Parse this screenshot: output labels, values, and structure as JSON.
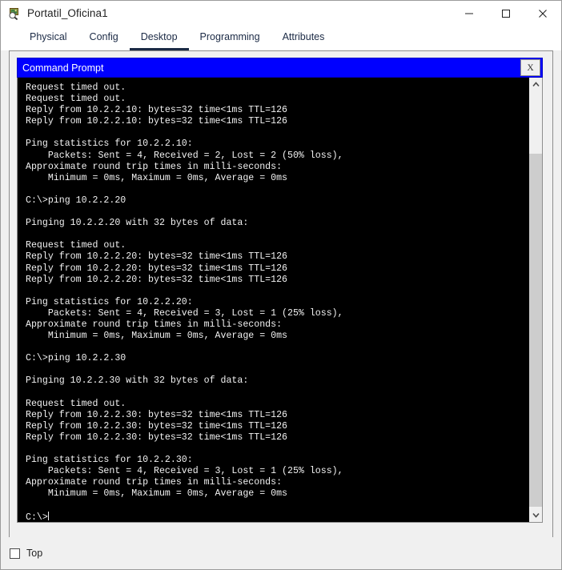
{
  "window": {
    "title": "Portatil_Oficina1",
    "icon": "packet-tracer-icon",
    "controls": {
      "minimize": "—",
      "maximize": "☐",
      "close": "✕"
    }
  },
  "tabs": [
    {
      "label": "Physical",
      "active": false
    },
    {
      "label": "Config",
      "active": false
    },
    {
      "label": "Desktop",
      "active": true
    },
    {
      "label": "Programming",
      "active": false
    },
    {
      "label": "Attributes",
      "active": false
    }
  ],
  "cmd_window": {
    "title": "Command Prompt",
    "close_label": "X",
    "accent_color": "#0000ff",
    "terminal_bg": "#000000",
    "terminal_fg": "#f2f2f2",
    "scrollbar": {
      "up_arrow": "∧",
      "down_arrow": "∨",
      "thumb_color": "#cdcdcd"
    },
    "terminal_text": "Request timed out.\nRequest timed out.\nReply from 10.2.2.10: bytes=32 time<1ms TTL=126\nReply from 10.2.2.10: bytes=32 time<1ms TTL=126\n\nPing statistics for 10.2.2.10:\n    Packets: Sent = 4, Received = 2, Lost = 2 (50% loss),\nApproximate round trip times in milli-seconds:\n    Minimum = 0ms, Maximum = 0ms, Average = 0ms\n\nC:\\>ping 10.2.2.20\n\nPinging 10.2.2.20 with 32 bytes of data:\n\nRequest timed out.\nReply from 10.2.2.20: bytes=32 time<1ms TTL=126\nReply from 10.2.2.20: bytes=32 time<1ms TTL=126\nReply from 10.2.2.20: bytes=32 time<1ms TTL=126\n\nPing statistics for 10.2.2.20:\n    Packets: Sent = 4, Received = 3, Lost = 1 (25% loss),\nApproximate round trip times in milli-seconds:\n    Minimum = 0ms, Maximum = 0ms, Average = 0ms\n\nC:\\>ping 10.2.2.30\n\nPinging 10.2.2.30 with 32 bytes of data:\n\nRequest timed out.\nReply from 10.2.2.30: bytes=32 time<1ms TTL=126\nReply from 10.2.2.30: bytes=32 time<1ms TTL=126\nReply from 10.2.2.30: bytes=32 time<1ms TTL=126\n\nPing statistics for 10.2.2.30:\n    Packets: Sent = 4, Received = 3, Lost = 1 (25% loss),\nApproximate round trip times in milli-seconds:\n    Minimum = 0ms, Maximum = 0ms, Average = 0ms\n\nC:\\>"
  },
  "bottom": {
    "top_checkbox_label": "Top",
    "top_checkbox_checked": false
  }
}
